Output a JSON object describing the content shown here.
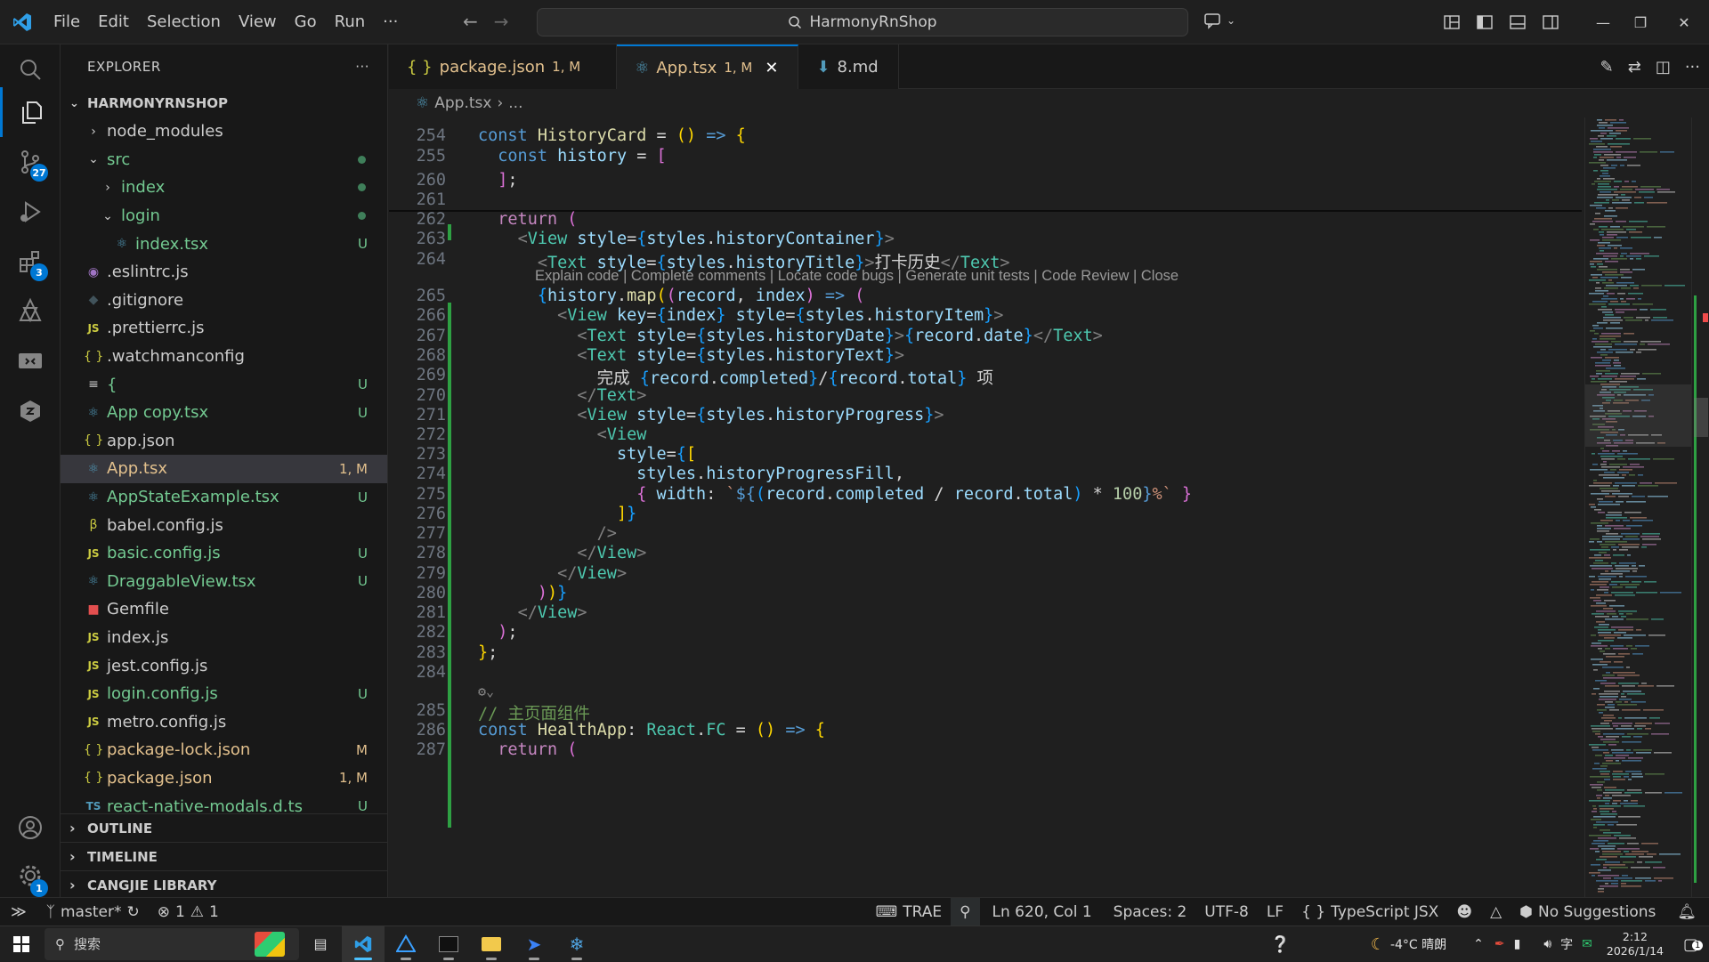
{
  "titlebar": {
    "menu": [
      "File",
      "Edit",
      "Selection",
      "View",
      "Go",
      "Run",
      "···"
    ],
    "search_text": "HarmonyRnShop"
  },
  "activity_bar": {
    "scm_badge": "27",
    "extensions_badge": "3",
    "settings_badge": "1"
  },
  "explorer": {
    "title": "EXPLORER",
    "more": "···",
    "root": "HARMONYRNSHOP",
    "items": [
      {
        "name": "node_modules",
        "indent": 1,
        "kind": "folder-closed",
        "color": "#cccccc",
        "status": ""
      },
      {
        "name": "src",
        "indent": 1,
        "kind": "folder-open",
        "color": "#73c991",
        "status": "dot"
      },
      {
        "name": "index",
        "indent": 2,
        "kind": "folder-closed",
        "color": "#73c991",
        "status": "dot"
      },
      {
        "name": "login",
        "indent": 2,
        "kind": "folder-open",
        "color": "#73c991",
        "status": "dot"
      },
      {
        "name": "index.tsx",
        "indent": 3,
        "kind": "tsx",
        "color": "#73c991",
        "status": "U"
      },
      {
        "name": ".eslintrc.js",
        "indent": 1,
        "kind": "eslint",
        "color": "#cccccc",
        "status": ""
      },
      {
        "name": ".gitignore",
        "indent": 1,
        "kind": "git",
        "color": "#cccccc",
        "status": ""
      },
      {
        "name": ".prettierrc.js",
        "indent": 1,
        "kind": "js",
        "color": "#cccccc",
        "status": ""
      },
      {
        "name": ".watchmanconfig",
        "indent": 1,
        "kind": "json",
        "color": "#cccccc",
        "status": ""
      },
      {
        "name": "{",
        "indent": 1,
        "kind": "text",
        "color": "#73c991",
        "status": "U"
      },
      {
        "name": "App copy.tsx",
        "indent": 1,
        "kind": "tsx",
        "color": "#73c991",
        "status": "U"
      },
      {
        "name": "app.json",
        "indent": 1,
        "kind": "json",
        "color": "#cccccc",
        "status": ""
      },
      {
        "name": "App.tsx",
        "indent": 1,
        "kind": "tsx",
        "color": "#e2c08d",
        "status": "1, M",
        "selected": true
      },
      {
        "name": "AppStateExample.tsx",
        "indent": 1,
        "kind": "tsx",
        "color": "#73c991",
        "status": "U"
      },
      {
        "name": "babel.config.js",
        "indent": 1,
        "kind": "babel",
        "color": "#cccccc",
        "status": ""
      },
      {
        "name": "basic.config.js",
        "indent": 1,
        "kind": "js",
        "color": "#73c991",
        "status": "U"
      },
      {
        "name": "DraggableView.tsx",
        "indent": 1,
        "kind": "tsx",
        "color": "#73c991",
        "status": "U"
      },
      {
        "name": "Gemfile",
        "indent": 1,
        "kind": "ruby",
        "color": "#cccccc",
        "status": ""
      },
      {
        "name": "index.js",
        "indent": 1,
        "kind": "js",
        "color": "#cccccc",
        "status": ""
      },
      {
        "name": "jest.config.js",
        "indent": 1,
        "kind": "js",
        "color": "#cccccc",
        "status": ""
      },
      {
        "name": "login.config.js",
        "indent": 1,
        "kind": "js",
        "color": "#73c991",
        "status": "U"
      },
      {
        "name": "metro.config.js",
        "indent": 1,
        "kind": "js",
        "color": "#cccccc",
        "status": ""
      },
      {
        "name": "package-lock.json",
        "indent": 1,
        "kind": "json",
        "color": "#e2c08d",
        "status": "M"
      },
      {
        "name": "package.json",
        "indent": 1,
        "kind": "json",
        "color": "#e2c08d",
        "status": "1, M"
      },
      {
        "name": "react-native-modals.d.ts",
        "indent": 1,
        "kind": "ts",
        "color": "#73c991",
        "status": "U"
      }
    ],
    "sections": [
      "OUTLINE",
      "TIMELINE",
      "CANGJIE LIBRARY"
    ]
  },
  "tabs": [
    {
      "icon": "{}",
      "name": "package.json",
      "mark": "1, M",
      "active": false
    },
    {
      "icon": "tsx",
      "name": "App.tsx",
      "mark": "1, M",
      "active": true
    },
    {
      "icon": "md",
      "name": "8.md",
      "mark": "",
      "active": false
    }
  ],
  "breadcrumb": {
    "file": "App.tsx",
    "rest": "..."
  },
  "codelens": "Explain code | Complete comments | Locate code bugs | Generate unit tests | Code Review | Close",
  "code_lines": [
    {
      "n": "254",
      "html": "<span class='k'>const</span> <span class='f'>HistoryCard</span> = <span class='b1'>()</span> <span class='k'>=&gt;</span> <span class='b1'>{</span>"
    },
    {
      "n": "255",
      "html": "  <span class='k'>const</span> <span class='v'>history</span> = <span class='b2'>[</span>"
    },
    {
      "n": "260",
      "html": "  <span class='b2'>]</span>;"
    },
    {
      "n": "261",
      "html": ""
    },
    {
      "n": "262",
      "html": "  <span class='kf'>return</span> <span class='b2'>(</span>"
    },
    {
      "n": "263",
      "html": "    <span class='p'>&lt;</span><span class='t'>View</span> <span class='v'>style</span>=<span class='b3'>{</span><span class='v'>styles</span>.<span class='v'>historyContainer</span><span class='b3'>}</span><span class='p'>&gt;</span>"
    },
    {
      "n": "264",
      "html": "      <span class='p'>&lt;</span><span class='t'>Text</span> <span class='v'>style</span>=<span class='b3'>{</span><span class='v'>styles</span>.<span class='v'>historyTitle</span><span class='b3'>}</span><span class='p'>&gt;</span>打卡历史<span class='p'>&lt;/</span><span class='t'>Text</span><span class='p'>&gt;</span>"
    },
    {
      "n": "265",
      "html": "      <span class='b3'>{</span><span class='v'>history</span>.<span class='f'>map</span><span class='b1'>(</span><span class='b2'>(</span><span class='v'>record</span>, <span class='v'>index</span><span class='b2'>)</span> <span class='k'>=&gt;</span> <span class='b2'>(</span>"
    },
    {
      "n": "266",
      "html": "        <span class='p'>&lt;</span><span class='t'>View</span> <span class='v'>key</span>=<span class='b3'>{</span><span class='v'>index</span><span class='b3'>}</span> <span class='v'>style</span>=<span class='b3'>{</span><span class='v'>styles</span>.<span class='v'>historyItem</span><span class='b3'>}</span><span class='p'>&gt;</span>"
    },
    {
      "n": "267",
      "html": "          <span class='p'>&lt;</span><span class='t'>Text</span> <span class='v'>style</span>=<span class='b3'>{</span><span class='v'>styles</span>.<span class='v'>historyDate</span><span class='b3'>}</span><span class='p'>&gt;</span><span class='b3'>{</span><span class='v'>record</span>.<span class='v'>date</span><span class='b3'>}</span><span class='p'>&lt;/</span><span class='t'>Text</span><span class='p'>&gt;</span>"
    },
    {
      "n": "268",
      "html": "          <span class='p'>&lt;</span><span class='t'>Text</span> <span class='v'>style</span>=<span class='b3'>{</span><span class='v'>styles</span>.<span class='v'>historyText</span><span class='b3'>}</span><span class='p'>&gt;</span>"
    },
    {
      "n": "269",
      "html": "            完成 <span class='b3'>{</span><span class='v'>record</span>.<span class='v'>completed</span><span class='b3'>}</span>/<span class='b3'>{</span><span class='v'>record</span>.<span class='v'>total</span><span class='b3'>}</span> 项"
    },
    {
      "n": "270",
      "html": "          <span class='p'>&lt;/</span><span class='t'>Text</span><span class='p'>&gt;</span>"
    },
    {
      "n": "271",
      "html": "          <span class='p'>&lt;</span><span class='t'>View</span> <span class='v'>style</span>=<span class='b3'>{</span><span class='v'>styles</span>.<span class='v'>historyProgress</span><span class='b3'>}</span><span class='p'>&gt;</span>"
    },
    {
      "n": "272",
      "html": "            <span class='p'>&lt;</span><span class='t'>View</span>"
    },
    {
      "n": "273",
      "html": "              <span class='v'>style</span>=<span class='b3'>{</span><span class='b1'>[</span>"
    },
    {
      "n": "274",
      "html": "                <span class='v'>styles</span>.<span class='v'>historyProgressFill</span>,"
    },
    {
      "n": "275",
      "html": "                <span class='b2'>{</span> <span class='v'>width</span>: <span class='s'>`</span><span class='k'>${</span><span class='b3'>(</span><span class='v'>record</span>.<span class='v'>completed</span> / <span class='v'>record</span>.<span class='v'>total</span><span class='b3'>)</span> * <span class='n'>100</span><span class='k'>}</span><span class='s'>%`</span> <span class='b2'>}</span>"
    },
    {
      "n": "276",
      "html": "              <span class='b1'>]</span><span class='b3'>}</span>"
    },
    {
      "n": "277",
      "html": "            <span class='p'>/&gt;</span>"
    },
    {
      "n": "278",
      "html": "          <span class='p'>&lt;/</span><span class='t'>View</span><span class='p'>&gt;</span>"
    },
    {
      "n": "279",
      "html": "        <span class='p'>&lt;/</span><span class='t'>View</span><span class='p'>&gt;</span>"
    },
    {
      "n": "280",
      "html": "      <span class='b2'>)</span><span class='b1'>)</span><span class='b3'>}</span>"
    },
    {
      "n": "281",
      "html": "    <span class='p'>&lt;/</span><span class='t'>View</span><span class='p'>&gt;</span>"
    },
    {
      "n": "282",
      "html": "  <span class='b2'>)</span>;"
    },
    {
      "n": "283",
      "html": "<span class='b1'>}</span>;"
    },
    {
      "n": "284",
      "html": ""
    },
    {
      "n": "",
      "html": "<span style='color:#8a8a8a;font-size:15px'>&#9881;&#8964;</span>"
    },
    {
      "n": "285",
      "html": "<span class='c'>// 主页面组件</span>"
    },
    {
      "n": "286",
      "html": "<span class='k'>const</span> <span class='f'>HealthApp</span>: <span class='t'>React</span>.<span class='t'>FC</span> = <span class='b1'>()</span> <span class='k'>=&gt;</span> <span class='b1'>{</span>"
    },
    {
      "n": "287",
      "html": "  <span class='kf'>return</span> <span class='b2'>(</span>"
    }
  ],
  "status": {
    "branch": "master*",
    "errors": "1",
    "warnings": "1",
    "trae": "TRAE",
    "position": "Ln 620, Col 1",
    "spaces": "Spaces: 2",
    "encoding": "UTF-8",
    "eol": "LF",
    "language": "TypeScript JSX",
    "suggestions": "No Suggestions"
  },
  "taskbar": {
    "search_placeholder": "搜索",
    "weather": "-4°C 晴朗",
    "time": "2:12",
    "date": "2026/1/14",
    "notif": "1"
  }
}
